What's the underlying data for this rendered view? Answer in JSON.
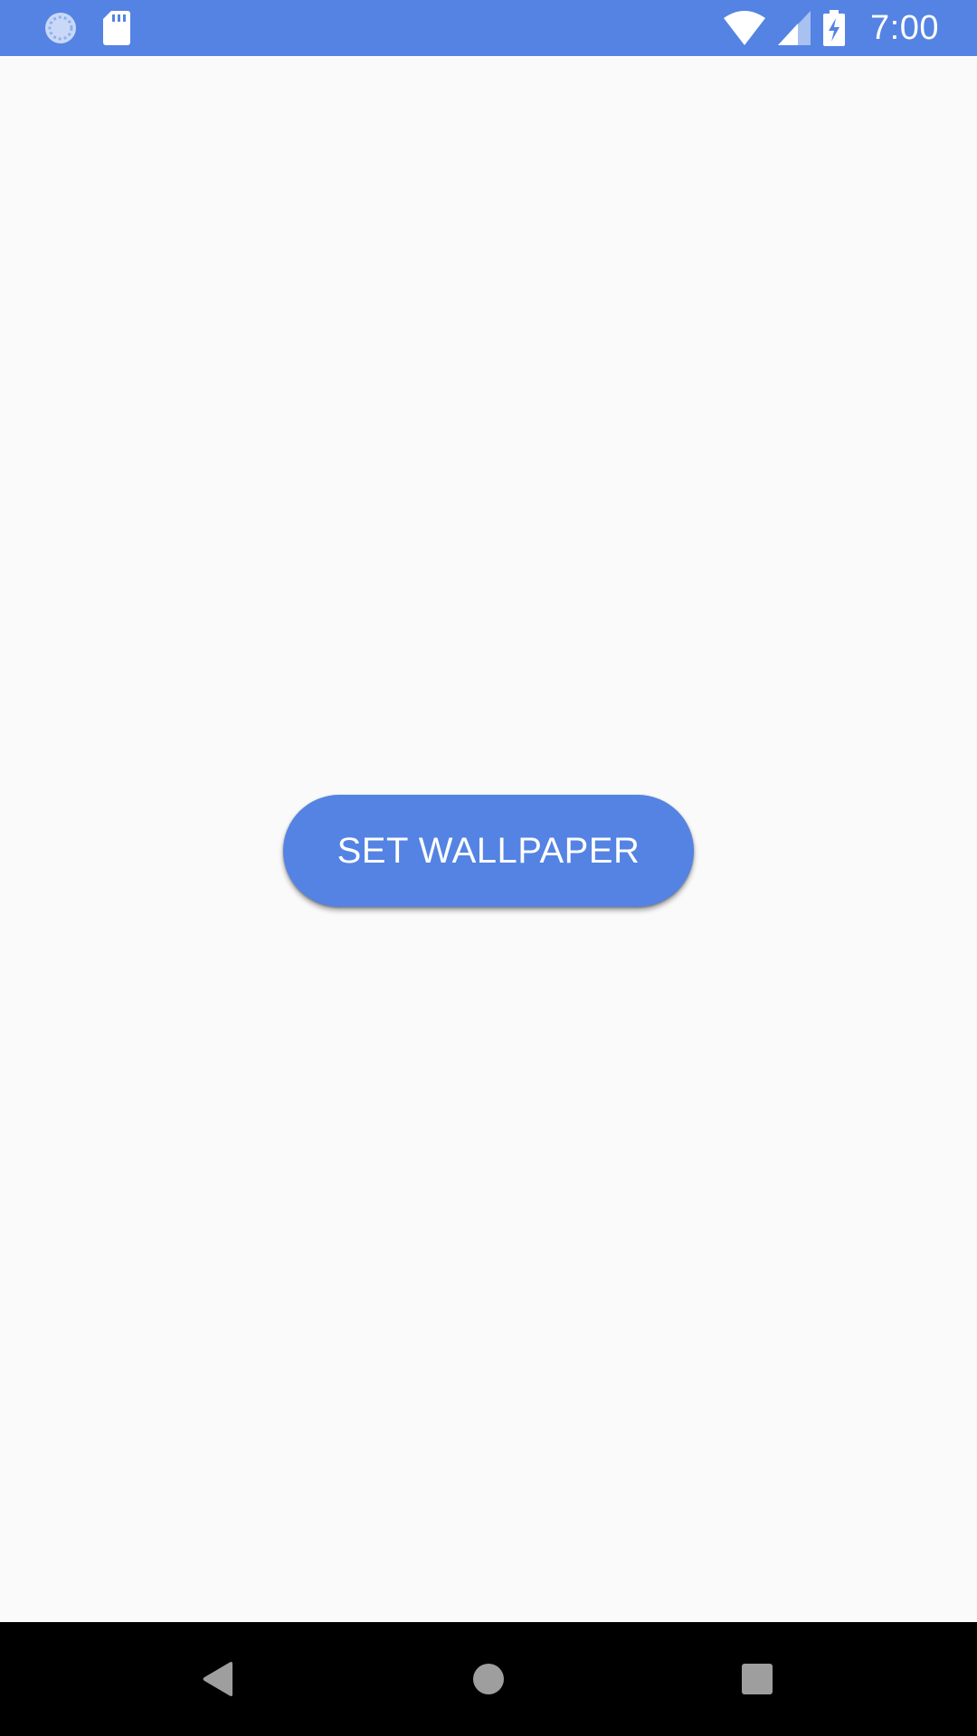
{
  "status_bar": {
    "time": "7:00",
    "background_color": "#5483e3",
    "icons_left": [
      "sync-icon",
      "sd-card-icon"
    ],
    "icons_right": [
      "wifi-icon",
      "cell-signal-icon",
      "battery-charging-icon"
    ]
  },
  "main": {
    "set_wallpaper_label": "SET WALLPAPER",
    "button_color": "#5483e3",
    "background_color": "#fafafa"
  },
  "nav_bar": {
    "background_color": "#000000",
    "buttons": [
      "back-icon",
      "home-icon",
      "recents-icon"
    ]
  }
}
